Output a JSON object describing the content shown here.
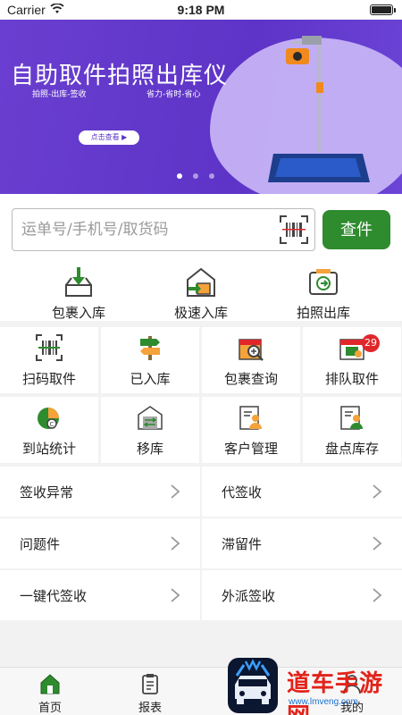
{
  "status_bar": {
    "carrier": "Carrier",
    "time": "9:18 PM"
  },
  "banner": {
    "title": "自助取件拍照出库仪",
    "subtitle_left": "拍照-出库-签收",
    "subtitle_right": "省力-省时-省心",
    "button_label": "点击查看 ▶",
    "page_count": 3,
    "active_page": 1
  },
  "search": {
    "placeholder": "运单号/手机号/取货码",
    "value": "",
    "button_label": "查件"
  },
  "quick_actions": [
    {
      "label": "包裹入库",
      "icon": "package-inbound-icon"
    },
    {
      "label": "极速入库",
      "icon": "fast-inbound-icon"
    },
    {
      "label": "拍照出库",
      "icon": "photo-outbound-icon"
    }
  ],
  "grid": [
    {
      "label": "扫码取件",
      "icon": "barcode-scan-icon",
      "badge": ""
    },
    {
      "label": "已入库",
      "icon": "signpost-icon",
      "badge": ""
    },
    {
      "label": "包裹查询",
      "icon": "package-search-icon",
      "badge": ""
    },
    {
      "label": "排队取件",
      "icon": "queue-pickup-icon",
      "badge": "29"
    },
    {
      "label": "到站统计",
      "icon": "pie-chart-icon",
      "badge": ""
    },
    {
      "label": "移库",
      "icon": "warehouse-move-icon",
      "badge": ""
    },
    {
      "label": "客户管理",
      "icon": "customer-icon",
      "badge": ""
    },
    {
      "label": "盘点库存",
      "icon": "inventory-icon",
      "badge": ""
    }
  ],
  "list": [
    {
      "label": "签收异常"
    },
    {
      "label": "代签收"
    },
    {
      "label": "问题件"
    },
    {
      "label": "滞留件"
    },
    {
      "label": "一键代签收"
    },
    {
      "label": "外派签收"
    }
  ],
  "tabbar": [
    {
      "label": "首页",
      "icon": "home-icon",
      "active": true
    },
    {
      "label": "报表",
      "icon": "report-icon",
      "active": false
    },
    {
      "label": "",
      "icon": "car-logo-icon",
      "active": false
    },
    {
      "label": "我的",
      "icon": "profile-icon",
      "active": false
    }
  ],
  "watermark": {
    "brand": "道车手游网",
    "url": "www.lmveng.com"
  },
  "colors": {
    "accent_green": "#2e8b2e",
    "banner_purple": "#6a3fd0",
    "badge_red": "#e0262b"
  }
}
